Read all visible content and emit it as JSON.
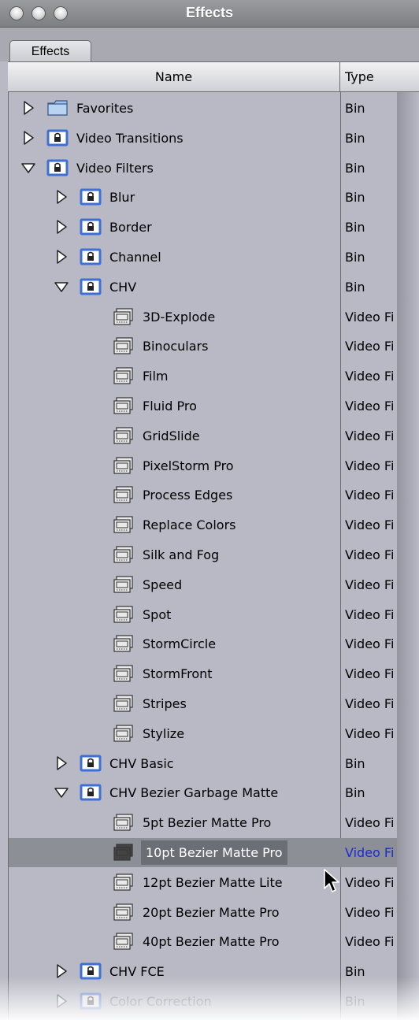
{
  "window": {
    "title": "Effects"
  },
  "tabs": [
    {
      "label": "Effects"
    }
  ],
  "columns": {
    "name": "Name",
    "type": "Type"
  },
  "colors": {
    "selection_row": "#8d8f96",
    "selection_label": "#6b6e74",
    "selected_type_text": "#1a2ad8",
    "bin_icon": "#3d6fd6"
  },
  "rows": [
    {
      "name": "Favorites",
      "type": "Bin",
      "level": 0,
      "icon": "folder-icon",
      "disclosure": "collapsed"
    },
    {
      "name": "Video Transitions",
      "type": "Bin",
      "level": 0,
      "icon": "locked-bin-icon",
      "disclosure": "collapsed"
    },
    {
      "name": "Video Filters",
      "type": "Bin",
      "level": 0,
      "icon": "locked-bin-icon",
      "disclosure": "expanded"
    },
    {
      "name": "Blur",
      "type": "Bin",
      "level": 1,
      "icon": "locked-bin-icon",
      "disclosure": "collapsed"
    },
    {
      "name": "Border",
      "type": "Bin",
      "level": 1,
      "icon": "locked-bin-icon",
      "disclosure": "collapsed"
    },
    {
      "name": "Channel",
      "type": "Bin",
      "level": 1,
      "icon": "locked-bin-icon",
      "disclosure": "collapsed"
    },
    {
      "name": "CHV",
      "type": "Bin",
      "level": 1,
      "icon": "locked-bin-icon",
      "disclosure": "expanded"
    },
    {
      "name": "3D-Explode",
      "type": "Video Fi",
      "level": 2,
      "icon": "filter-icon",
      "disclosure": "none"
    },
    {
      "name": "Binoculars",
      "type": "Video Fi",
      "level": 2,
      "icon": "filter-icon",
      "disclosure": "none"
    },
    {
      "name": "Film",
      "type": "Video Fi",
      "level": 2,
      "icon": "filter-icon",
      "disclosure": "none"
    },
    {
      "name": "Fluid Pro",
      "type": "Video Fi",
      "level": 2,
      "icon": "filter-icon",
      "disclosure": "none"
    },
    {
      "name": "GridSlide",
      "type": "Video Fi",
      "level": 2,
      "icon": "filter-icon",
      "disclosure": "none"
    },
    {
      "name": "PixelStorm Pro",
      "type": "Video Fi",
      "level": 2,
      "icon": "filter-icon",
      "disclosure": "none"
    },
    {
      "name": "Process Edges",
      "type": "Video Fi",
      "level": 2,
      "icon": "filter-icon",
      "disclosure": "none"
    },
    {
      "name": "Replace Colors",
      "type": "Video Fi",
      "level": 2,
      "icon": "filter-icon",
      "disclosure": "none"
    },
    {
      "name": "Silk and Fog",
      "type": "Video Fi",
      "level": 2,
      "icon": "filter-icon",
      "disclosure": "none"
    },
    {
      "name": "Speed",
      "type": "Video Fi",
      "level": 2,
      "icon": "filter-icon",
      "disclosure": "none"
    },
    {
      "name": "Spot",
      "type": "Video Fi",
      "level": 2,
      "icon": "filter-icon",
      "disclosure": "none"
    },
    {
      "name": "StormCircle",
      "type": "Video Fi",
      "level": 2,
      "icon": "filter-icon",
      "disclosure": "none"
    },
    {
      "name": "StormFront",
      "type": "Video Fi",
      "level": 2,
      "icon": "filter-icon",
      "disclosure": "none"
    },
    {
      "name": "Stripes",
      "type": "Video Fi",
      "level": 2,
      "icon": "filter-icon",
      "disclosure": "none"
    },
    {
      "name": "Stylize",
      "type": "Video Fi",
      "level": 2,
      "icon": "filter-icon",
      "disclosure": "none"
    },
    {
      "name": "CHV Basic",
      "type": "Bin",
      "level": 1,
      "icon": "locked-bin-icon",
      "disclosure": "collapsed"
    },
    {
      "name": "CHV Bezier Garbage Matte",
      "type": "Bin",
      "level": 1,
      "icon": "locked-bin-icon",
      "disclosure": "expanded"
    },
    {
      "name": " 5pt Bezier Matte Pro",
      "type": "Video Fi",
      "level": 2,
      "icon": "filter-icon",
      "disclosure": "none"
    },
    {
      "name": "10pt Bezier Matte Pro",
      "type": "Video Fi",
      "level": 2,
      "icon": "filter-icon",
      "disclosure": "none",
      "selected": true
    },
    {
      "name": "12pt Bezier Matte Lite",
      "type": "Video Fi",
      "level": 2,
      "icon": "filter-icon",
      "disclosure": "none"
    },
    {
      "name": "20pt Bezier Matte Pro",
      "type": "Video Fi",
      "level": 2,
      "icon": "filter-icon",
      "disclosure": "none"
    },
    {
      "name": "40pt Bezier Matte Pro",
      "type": "Video Fi",
      "level": 2,
      "icon": "filter-icon",
      "disclosure": "none"
    },
    {
      "name": "CHV FCE",
      "type": "Bin",
      "level": 1,
      "icon": "locked-bin-icon",
      "disclosure": "collapsed"
    },
    {
      "name": "Color Correction",
      "type": "Bin",
      "level": 1,
      "icon": "locked-bin-icon",
      "disclosure": "collapsed",
      "dimmed": true
    }
  ]
}
